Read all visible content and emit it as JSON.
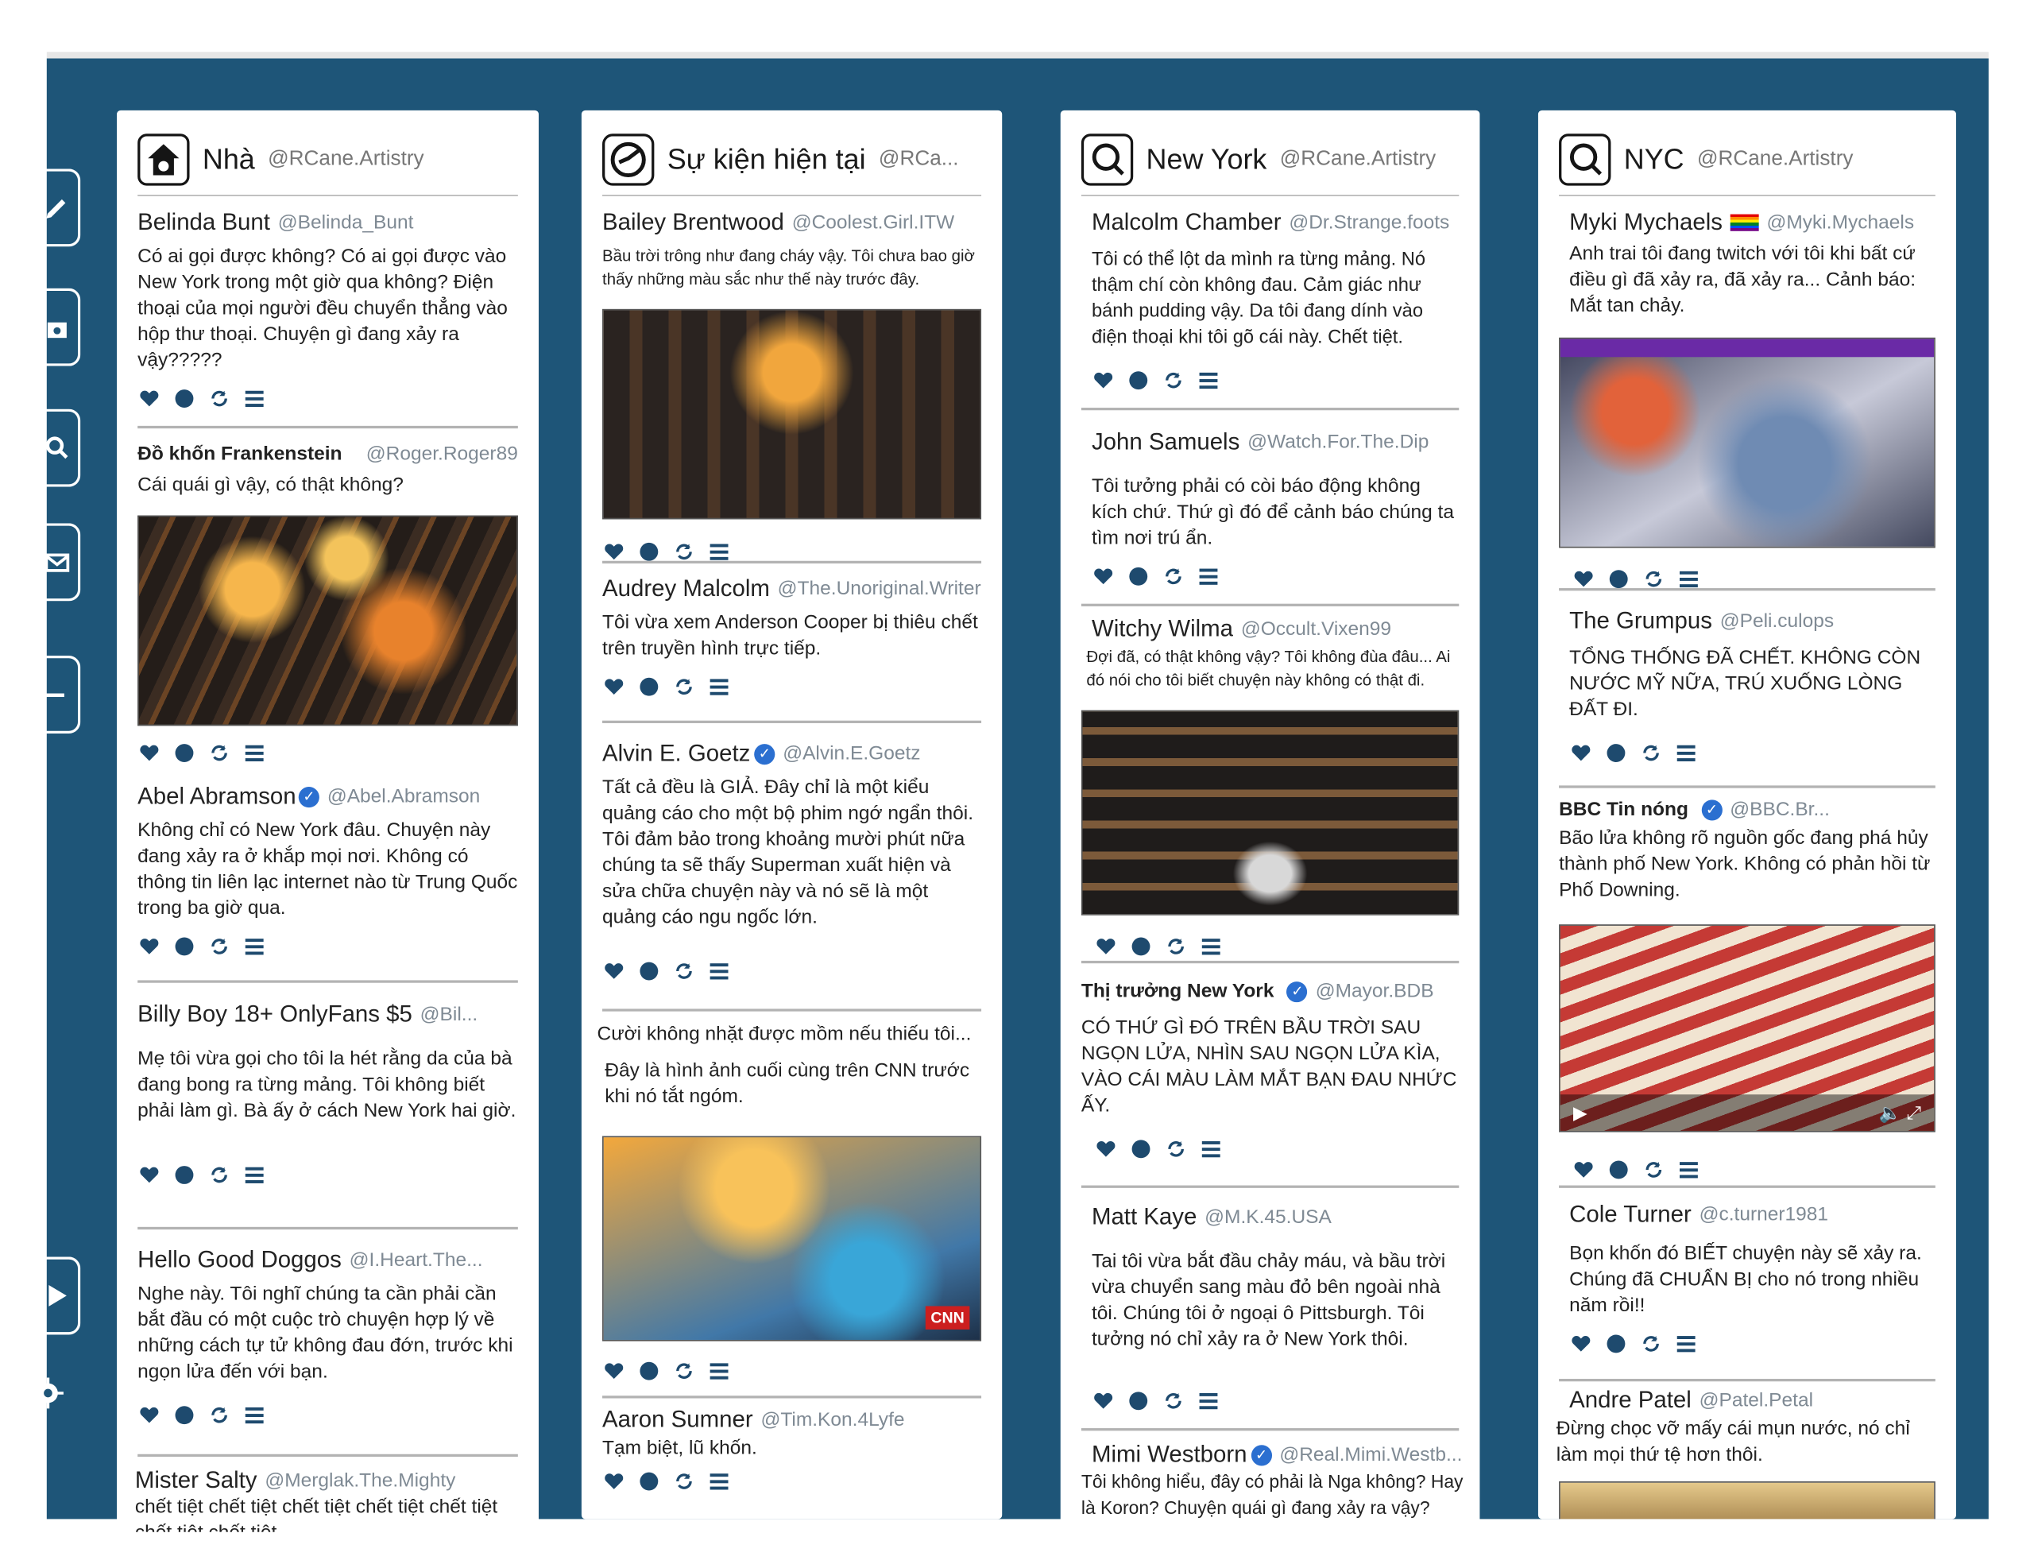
{
  "columns": [
    {
      "title": "Nhà",
      "handle": "@RCane.Artistry",
      "icon": "home-icon",
      "posts": [
        {
          "name": "Belinda Bunt",
          "handle": "@Belinda_Bunt",
          "text": "Có ai gọi được không? Có ai gọi được vào New York trong một giờ qua không? Điện thoại của mọi người đều chuyển thẳng vào hộp thư thoại. Chuyện gì đang xảy ra vậy?????"
        },
        {
          "name": "Đồ khốn Frankenstein",
          "handle": "@Roger.Roger89",
          "text": "Cái quái gì vậy, có thật không?"
        },
        {
          "name": "Abel Abramson",
          "handle": "@Abel.Abramson",
          "text": "Không chỉ có New York đâu. Chuyện này đang xảy ra ở khắp mọi nơi. Không có thông tin liên lạc internet nào từ Trung Quốc trong ba giờ qua."
        },
        {
          "name": "Billy Boy 18+ OnlyFans $5",
          "handle": "@Bil...",
          "text": "Mẹ tôi vừa gọi cho tôi la hét rằng da của bà đang bong ra từng mảng. Tôi không biết phải làm gì. Bà ấy ở cách New York hai giờ."
        },
        {
          "name": "Hello Good Doggos",
          "handle": "@I.Heart.The...",
          "text": "Nghe này. Tôi nghĩ chúng ta cần phải cần bắt đầu có một cuộc trò chuyện hợp lý về những cách tự tử không đau đớn, trước khi ngọn lửa đến với bạn."
        },
        {
          "name": "Mister Salty",
          "handle": "@Merglak.The.Mighty",
          "text": "chết tiệt chết tiệt chết tiệt chết tiệt chết tiệt chết tiệt chết tiệt"
        }
      ]
    },
    {
      "title": "Sự kiện hiện tại",
      "handle": "@RCa...",
      "icon": "clock-icon",
      "posts": [
        {
          "name": "Bailey Brentwood",
          "handle": "@Coolest.Girl.ITW",
          "text": "Bầu trời trông như đang cháy vậy. Tôi chưa bao giờ thấy những màu sắc như thế này trước đây."
        },
        {
          "name": "Audrey Malcolm",
          "handle": "@The.Unoriginal.Writer",
          "text": "Tôi vừa xem Anderson Cooper bị thiêu chết trên truyền hình trực tiếp."
        },
        {
          "name": "Alvin E. Goetz",
          "handle": "@Alvin.E.Goetz",
          "text": "Tất cả đều là GIẢ. Đây chỉ là một kiểu quảng cáo cho một bộ phim ngớ ngẩn thôi. Tôi đảm bảo trong khoảng mười phút nữa chúng ta sẽ thấy Superman xuất hiện và sửa chữa chuyện này và nó sẽ là một quảng cáo ngu ngốc lớn."
        },
        {
          "name": "Cười không nhặt được mồm nếu thiếu tôi...",
          "handle": "",
          "text": "Đây là hình ảnh cuối cùng trên CNN trước khi nó tắt ngóm."
        },
        {
          "name": "Aaron Sumner",
          "handle": "@Tim.Kon.4Lyfe",
          "text": "Tạm biệt, lũ khốn."
        }
      ],
      "cnn_logo": "CNN"
    },
    {
      "title": "New York",
      "handle": "@RCane.Artistry",
      "icon": "search-icon",
      "posts": [
        {
          "name": "Malcolm Chamber",
          "handle": "@Dr.Strange.foots",
          "text": "Tôi có thể lột da mình ra từng mảng. Nó thậm chí còn không đau. Cảm giác như bánh pudding vậy. Da tôi đang dính vào điện thoại khi tôi gõ cái này. Chết tiệt."
        },
        {
          "name": "John Samuels",
          "handle": "@Watch.For.The.Dip",
          "text": "Tôi tưởng phải có còi báo động không kích chứ. Thứ gì đó để cảnh báo chúng ta tìm nơi trú ẩn."
        },
        {
          "name": "Witchy Wilma",
          "handle": "@Occult.Vixen99",
          "text": "Đợi đã, có thật không vậy? Tôi không đùa đâu... Ai đó nói cho tôi biết chuyện này không có thật đi."
        },
        {
          "name": "Thị trưởng New York",
          "handle": "@Mayor.BDB",
          "text": "CÓ THỨ GÌ ĐÓ TRÊN BẦU TRỜI SAU NGỌN LỬA, NHÌN SAU NGỌN LỬA KÌA, VÀO CÁI MÀU LÀM MẮT BẠN ĐAU NHỨC ẤY."
        },
        {
          "name": "Matt Kaye",
          "handle": "@M.K.45.USA",
          "text": "Tai tôi vừa bắt đầu chảy máu, và bầu trời vừa chuyển sang màu đỏ bên ngoài nhà tôi. Chúng tôi ở ngoại ô Pittsburgh. Tôi tưởng nó chỉ xảy ra ở New York thôi."
        },
        {
          "name": "Mimi Westborn",
          "handle": "@Real.Mimi.Westb...",
          "text": "Tôi không hiểu, đây có phải là Nga không? Hay là Koron? Chuyện quái gì đang xảy ra vậy?"
        }
      ]
    },
    {
      "title": "NYC",
      "handle": "@RCane.Artistry",
      "icon": "search-icon",
      "posts": [
        {
          "name": "Myki Mychaels",
          "handle": "@Myki.Mychaels",
          "text": "Anh trai tôi đang twitch với tôi khi bất cứ điều gì đã xảy ra, đã xảy ra... Cảnh báo: Mắt tan chảy."
        },
        {
          "name": "The Grumpus",
          "handle": "@Peli.culops",
          "text": "TỔNG THỐNG ĐÃ CHẾT. KHÔNG CÒN NƯỚC MỸ NỮA, TRÚ XUỐNG LÒNG ĐẤT ĐI."
        },
        {
          "name": "BBC Tin nóng",
          "handle": "@BBC.Br...",
          "text": "Bão lửa không rõ nguồn gốc đang phá hủy thành phố New York. Không có phản hồi từ Phố Downing."
        },
        {
          "name": "Cole Turner",
          "handle": "@c.turner1981",
          "text": "Bọn khốn đó BIẾT chuyện này sẽ xảy ra. Chúng đã CHUẨN BỊ cho nó trong nhiều năm rồi!!"
        },
        {
          "name": "Andre Patel",
          "handle": "@Patel.Petal",
          "text": "Đừng chọc vỡ mấy cái mụn nước, nó chỉ làm mọi thứ tệ hơn thôi."
        }
      ]
    }
  ],
  "colors": {
    "board": "#1e5578",
    "icon": "#1e4a6e"
  }
}
